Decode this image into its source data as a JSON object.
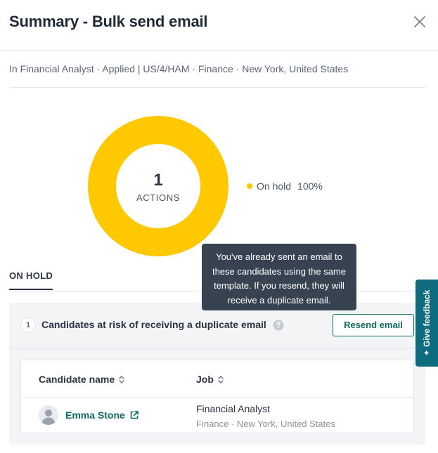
{
  "header": {
    "title": "Summary - Bulk send email",
    "close_icon": "close-icon"
  },
  "context": {
    "subtitle": "In Financial Analyst · Applied | US/4/HAM · Finance · New York, United States"
  },
  "summary": {
    "count": "1",
    "count_label": "ACTIONS",
    "legend_name": "On hold",
    "legend_percent": "100%",
    "color": "#FFC800"
  },
  "chart_data": {
    "type": "pie",
    "categories": [
      "On hold"
    ],
    "values": [
      100
    ],
    "colors": [
      "#FFC800"
    ]
  },
  "tabs": [
    {
      "label": "ON HOLD",
      "active": true
    }
  ],
  "tooltip": {
    "text": "You've already sent an email to these candidates using the same template. If you resend, they will receive a duplicate email."
  },
  "panel": {
    "count": "1",
    "title": "Candidates at risk of receiving a duplicate email",
    "help_icon": "question-circle-icon",
    "resend_label": "Resend email"
  },
  "table": {
    "columns": [
      {
        "label": "Candidate name",
        "sort_icon": "sort-icon"
      },
      {
        "label": "Job",
        "sort_icon": "sort-icon"
      }
    ],
    "rows": [
      {
        "candidate": "Emma Stone",
        "link_icon": "external-link-icon",
        "job_title": "Financial Analyst",
        "job_meta": "Finance · New York, United States"
      }
    ]
  },
  "feedback": {
    "label": "✦ Give feedback"
  },
  "colors": {
    "accent": "#0F6B5E",
    "donut": "#FFC800",
    "tooltip_bg": "#384351",
    "feedback_bg": "#0F6B7E"
  }
}
